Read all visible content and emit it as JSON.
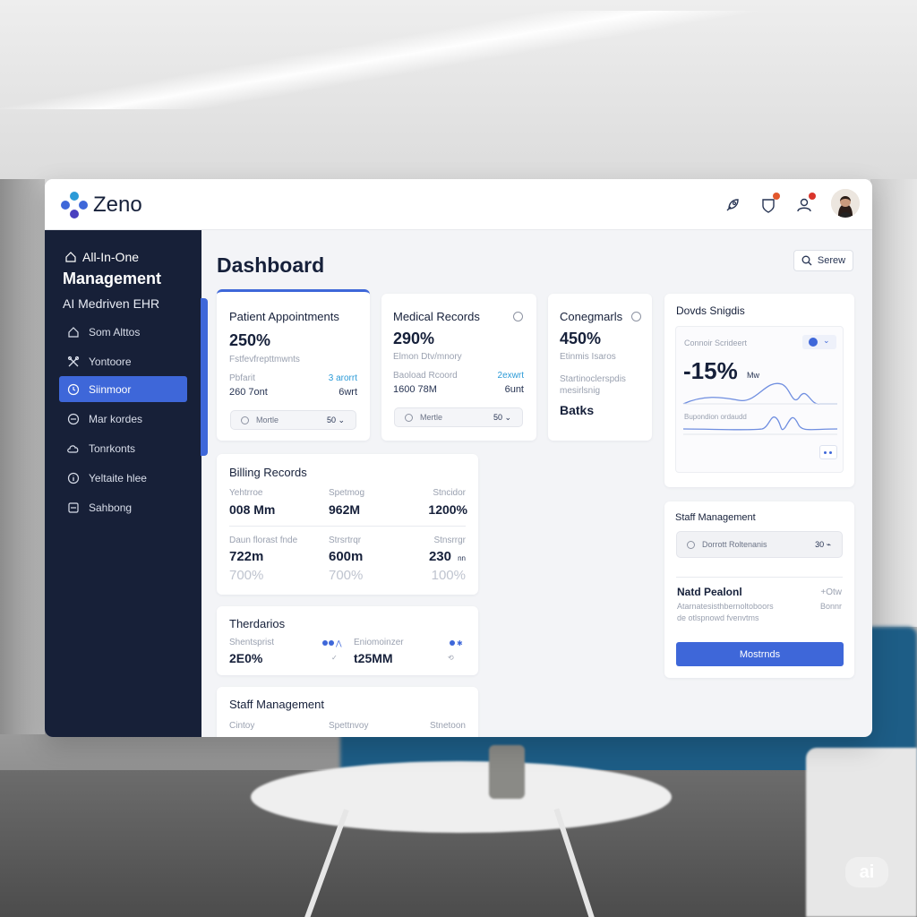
{
  "app": {
    "brand": "Zeno",
    "colors": {
      "accent": "#3e67d9",
      "sidebar": "#172038",
      "highlight": "#2b9ad7"
    }
  },
  "topbar": {
    "icons": [
      "rocket-icon",
      "shield-icon",
      "user-icon",
      "avatar"
    ]
  },
  "sidebar": {
    "eyebrow": "All-In-One",
    "title": "Management",
    "subtitle": "AI Medriven EHR",
    "items": [
      {
        "label": "Som Alttos",
        "icon": "home-icon"
      },
      {
        "label": "Yontoore",
        "icon": "tools-icon"
      },
      {
        "label": "Siinmoor",
        "icon": "clock-icon",
        "active": true
      },
      {
        "label": "Mar kordes",
        "icon": "minus-circle-icon"
      },
      {
        "label": "Tonrkonts",
        "icon": "cloud-icon"
      },
      {
        "label": "Yeltaite hlee",
        "icon": "info-icon"
      },
      {
        "label": "Sahbong",
        "icon": "box-icon"
      }
    ]
  },
  "main": {
    "title": "Dashboard",
    "search_label": "Serew"
  },
  "cards": {
    "appointments": {
      "title": "Patient Appointments",
      "value": "250%",
      "caption": "Fstfevfrepttmwnts",
      "left_label": "Pbfarit",
      "right_label": "3 arorrt",
      "left_value": "260 7ont",
      "right_value": "6wrt",
      "select_label": "Mortle",
      "select_value": "50 ⌄"
    },
    "records": {
      "title": "Medical Records",
      "value": "290%",
      "caption": "Elmon Dtv/mnory",
      "left_label": "Baoload Rcoord",
      "right_label": "2exwrt",
      "left_value": "1600 78M",
      "right_value": "6unt",
      "select_label": "Mertle",
      "select_value": "50 ⌄"
    },
    "congo": {
      "title": "Conegmarls",
      "value": "450%",
      "caption": "Etinmis Isaros",
      "desc1": "Startinoclerspdis",
      "desc2": "mesirlsnig",
      "footer": "Batks"
    },
    "trends": {
      "title": "Dovds Snigdis",
      "label": "Connoir Scrideert",
      "value": "-15%",
      "unit": "Mw",
      "line_label": "Bupondion ordaudd"
    },
    "billing": {
      "title": "Billing Records",
      "row1_labels": [
        "Yehtrroe",
        "Spetmog",
        "Stncidor"
      ],
      "row1_values": [
        "008 Mm",
        "962M",
        "1200%"
      ],
      "row2_labels": [
        "Daun florast fnde",
        "Strsrtrqr",
        "Stnsrrgr"
      ],
      "row2_values": [
        "722m",
        "600m",
        "230"
      ],
      "row2_unit": "nn",
      "row3_values": [
        "700%",
        "700%",
        "100%"
      ]
    },
    "therapies": {
      "title": "Therdarios",
      "label1": "Shentsprist",
      "value1": "2E0%",
      "label2": "Eniomoinzer",
      "value2": "t25MM"
    },
    "staff_bottom": {
      "title": "Staff Management",
      "labels": [
        "Cintoy",
        "Spettnvoy",
        "Stnetoon"
      ]
    },
    "staff_right": {
      "title": "Staff Management",
      "select_label": "Dorrott Roltenanis",
      "select_value": "30 ⌁",
      "patient_name": "Natd Pealonl",
      "patient_meta": "+Otw",
      "desc1": "Atarnatesisthbernoltoboors",
      "desc2": "de otlspnowd fvenvtms",
      "desc_right": "Bonnr",
      "button": "Mostrnds"
    }
  }
}
